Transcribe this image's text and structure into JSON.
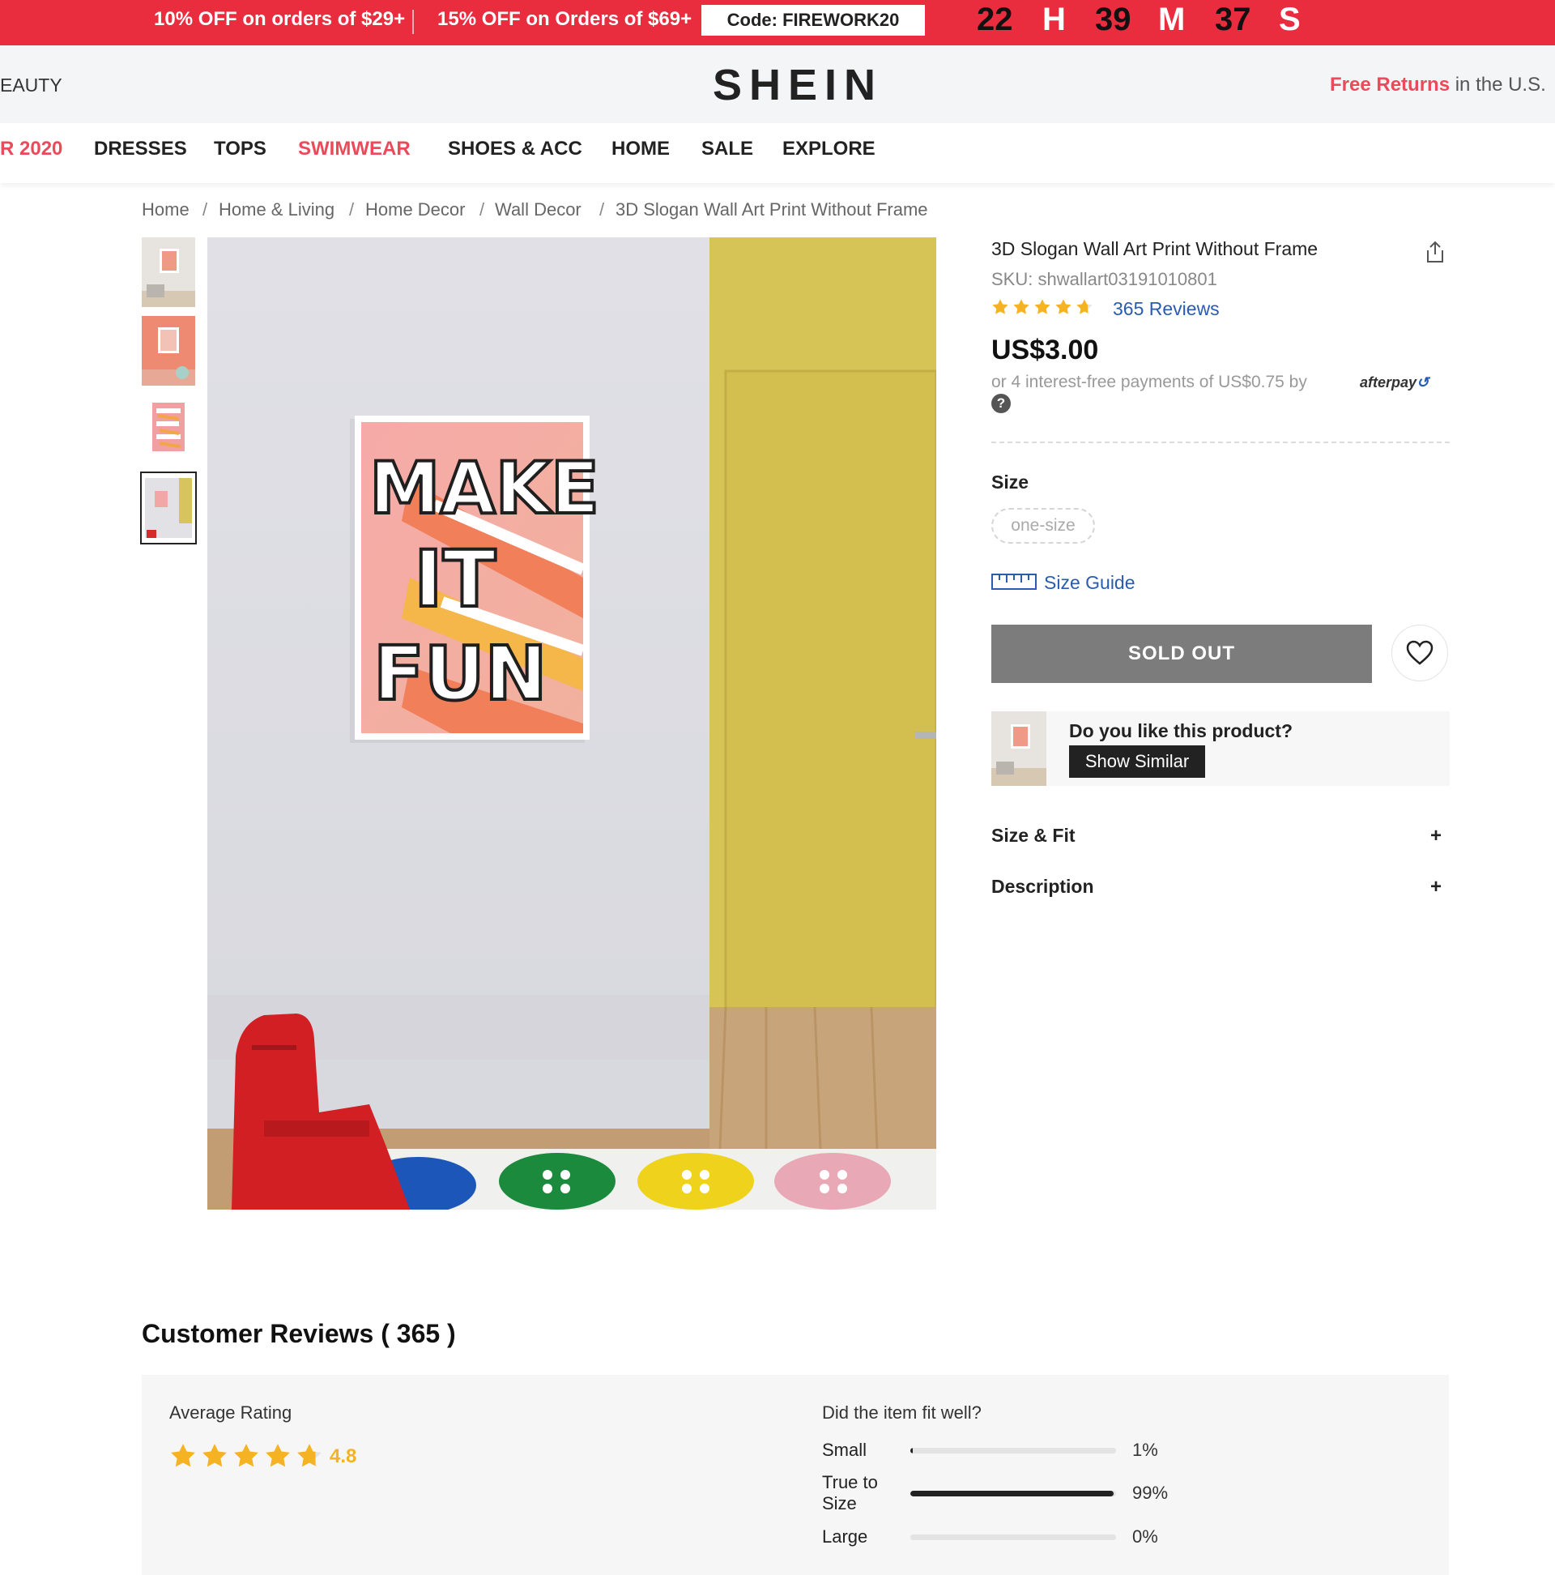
{
  "promo": {
    "offer1": "10% OFF on orders of $29+",
    "offer2": "15% OFF on Orders of $69+",
    "code": "Code: FIREWORK20",
    "timer": {
      "hours": "22",
      "h": "H",
      "minutes": "39",
      "m": "M",
      "seconds": "37",
      "s": "S"
    }
  },
  "header": {
    "left_partial": "EAUTY",
    "logo": "SHEIN",
    "returns_link": "Free Returns",
    "returns_rest": " in the U.S."
  },
  "nav": [
    "R 2020",
    "DRESSES",
    "TOPS",
    "SWIMWEAR",
    "SHOES & ACC",
    "HOME",
    "SALE",
    "EXPLORE"
  ],
  "breadcrumb": [
    "Home",
    "Home & Living",
    "Home Decor",
    "Wall Decor",
    "3D Slogan Wall Art Print Without Frame"
  ],
  "product": {
    "title": "3D Slogan Wall Art Print Without Frame",
    "sku": "SKU: shwallart03191010801",
    "rating": 4.8,
    "reviews_link": "365 Reviews",
    "price": "US$3.00",
    "installments": "or 4 interest-free payments of US$0.75 by",
    "afterpay_logo": "afterpay",
    "help_glyph": "?",
    "size_label": "Size",
    "size_option": "one-size",
    "size_guide": "Size Guide",
    "sold_out": "SOLD OUT",
    "similar_question": "Do you like this product?",
    "show_similar": "Show Similar",
    "accordions": [
      {
        "label": "Size & Fit",
        "icon": "+"
      },
      {
        "label": "Description",
        "icon": "+"
      }
    ],
    "poster_text": [
      "MAKE",
      "IT",
      "FUN"
    ]
  },
  "reviews": {
    "title": "Customer Reviews ( 365 )",
    "avg_label": "Average Rating",
    "avg_value": "4.8",
    "fit_question": "Did the item fit well?",
    "fit": [
      {
        "label": "Small",
        "pct_text": "1%",
        "value": 0.01
      },
      {
        "label": "True to Size",
        "pct_text": "99%",
        "value": 0.99
      },
      {
        "label": "Large",
        "pct_text": "0%",
        "value": 0.0
      }
    ]
  },
  "colors": {
    "promo_red": "#ea2c3f",
    "accent_red": "#ea4a5a",
    "link_blue": "#2a5bb0",
    "star_gold": "#f5b323",
    "soldout_gray": "#7c7c7c"
  },
  "icons": [
    "share-icon",
    "star-icon",
    "question-icon",
    "ruler-icon",
    "heart-icon",
    "plus-icon"
  ]
}
